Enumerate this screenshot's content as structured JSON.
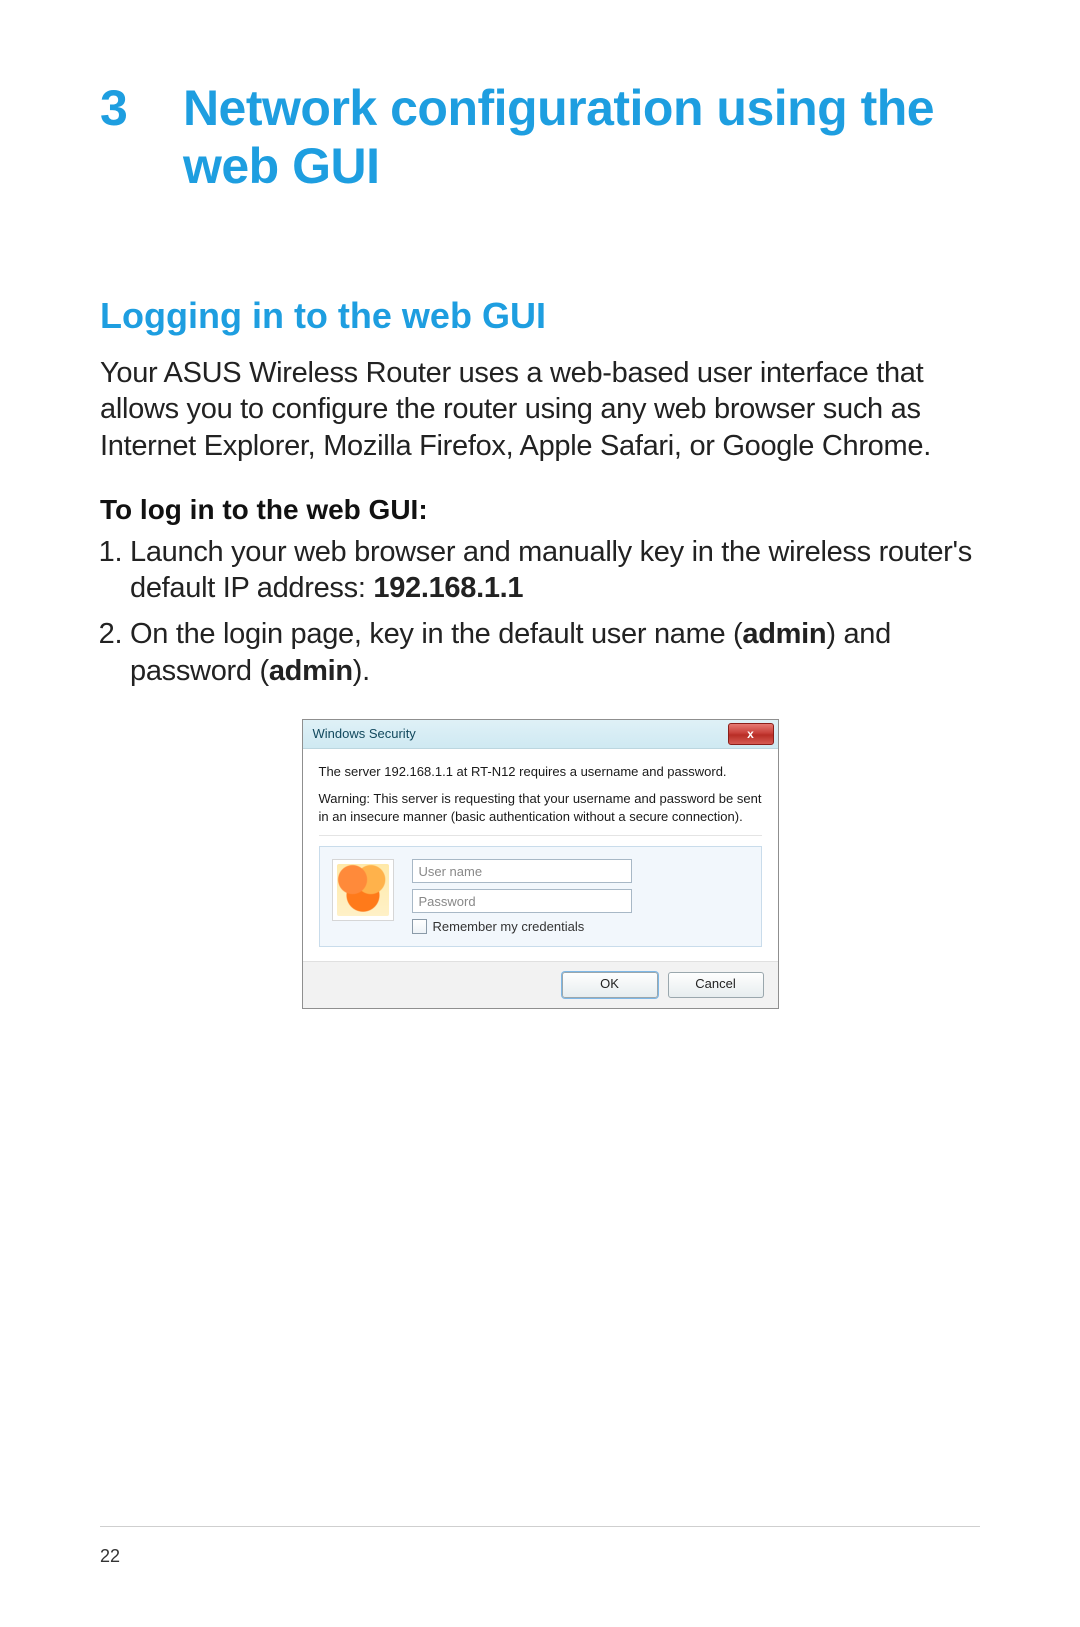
{
  "chapter": {
    "number": "3",
    "title": "Network configuration using the web GUI"
  },
  "section_title": "Logging in to the web GUI",
  "intro_paragraph": "Your ASUS Wireless Router uses a web-based user interface that allows you to configure the router using any web browser such as Internet Explorer, Mozilla Firefox, Apple Safari, or Google Chrome.",
  "subheading": "To log in to the web GUI:",
  "steps": {
    "one_prefix": "Launch your web browser and manually key in the wireless router's default IP address: ",
    "one_ip": "192.168.1.1",
    "two_a": "On the login page, key in the default user name (",
    "two_admin1": "admin",
    "two_b": ") and password (",
    "two_admin2": "admin",
    "two_c": ")."
  },
  "dialog": {
    "title": "Windows Security",
    "close_glyph": "x",
    "msg1": "The server 192.168.1.1 at RT-N12 requires a username and password.",
    "msg2": "Warning: This server is requesting that your username and password be sent in an insecure manner (basic authentication without a secure connection).",
    "username_placeholder": "User name",
    "password_placeholder": "Password",
    "remember_label": "Remember my credentials",
    "ok": "OK",
    "cancel": "Cancel"
  },
  "page_number": "22"
}
